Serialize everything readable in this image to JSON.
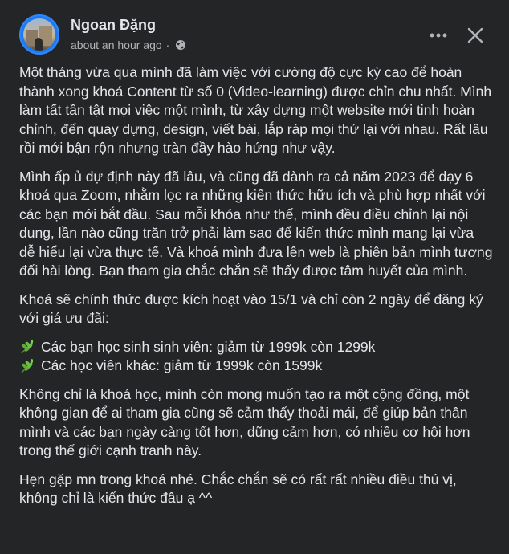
{
  "post": {
    "author": "Ngoan Đặng",
    "timestamp": "about an hour ago",
    "separator": "·",
    "privacy_icon": "globe-icon",
    "more_icon": "more-horizontal-icon",
    "close_icon": "close-icon"
  },
  "content": {
    "paragraph1": "Một tháng vừa qua mình đã làm việc với cường độ cực kỳ cao để hoàn thành xong khoá Content từ số 0 (Video-learning) được chỉn chu nhất. Mình làm tất tần tật mọi việc một mình, từ xây dựng một website mới tinh hoàn chỉnh, đến quay dựng, design, viết bài, lắp ráp mọi thứ lại với nhau. Rất lâu rồi mới bận rộn nhưng tràn đầy hào hứng như vậy.",
    "paragraph2": "Mình ấp ủ dự định này đã lâu, và cũng đã dành ra cả năm 2023 để dạy 6 khoá qua Zoom, nhằm lọc ra những kiến thức hữu ích và phù hợp nhất với các bạn mới bắt đầu. Sau mỗi khóa như thế, mình đều điều chỉnh lại nội dung, lần nào cũng trăn trở phải làm sao để kiến thức mình mang lại vừa dễ hiểu lại vừa thực tế. Và khoá mình đưa lên web là phiên bản mình tương đối hài lòng. Bạn tham gia chắc chắn sẽ thấy được tâm huyết của mình.",
    "paragraph3": "Khoá sẽ chính thức được kích hoạt vào 15/1 và chỉ còn 2 ngày để đăng ký với giá ưu đãi:",
    "bullets": [
      "Các bạn học sinh sinh viên: giảm từ 1999k còn 1299k",
      "Các học viên khác: giảm từ 1999k còn 1599k"
    ],
    "bullet_icon": "herb-leaf-icon",
    "paragraph4": "Không chỉ là khoá học, mình còn mong muốn tạo ra một cộng đồng, một không gian để ai tham gia cũng sẽ cảm thấy thoải mái, để giúp bản thân mình và các bạn ngày càng tốt hơn, dũng cảm hơn, có nhiều cơ hội hơn trong thế giới cạnh tranh này.",
    "paragraph5": "Hẹn gặp mn trong khoá nhé. Chắc chắn sẽ có rất rất nhiều điều thú vị, không chỉ là kiến thức đâu ạ ^^"
  },
  "colors": {
    "background": "#242526",
    "text": "#e4e6eb",
    "secondary_text": "#b0b3b8",
    "avatar_ring": "#2d88ff",
    "leaf": "#5fae3a"
  }
}
